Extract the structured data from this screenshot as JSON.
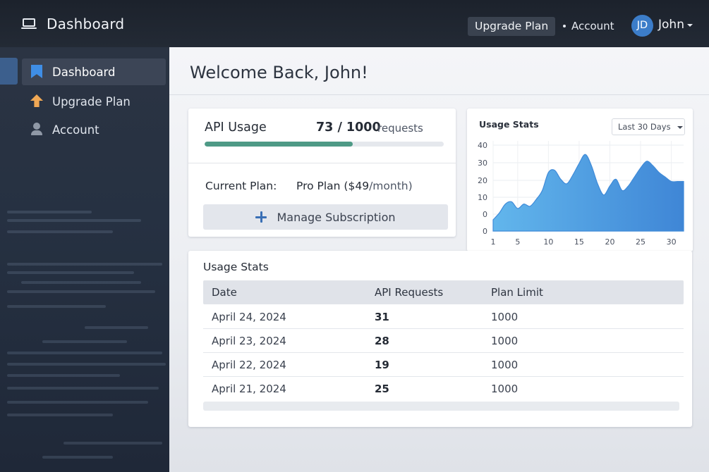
{
  "header": {
    "brand_title": "Dashboard",
    "upgrade_label": "Upgrade Plan",
    "account_label": "Account",
    "avatar_initials": "JD",
    "user_name": "John",
    "icons": {
      "brand": "laptop-icon",
      "user_menu": "chevron-down-icon"
    }
  },
  "sidebar": {
    "items": [
      {
        "label": "Dashboard",
        "icon": "bookmark-icon",
        "active": true,
        "color": "#3f8ee6"
      },
      {
        "label": "Upgrade Plan",
        "icon": "arrow-up-icon",
        "active": false,
        "color": "#f0a855"
      },
      {
        "label": "Account",
        "icon": "user-icon",
        "active": false,
        "color": "#8f98a6"
      }
    ]
  },
  "main": {
    "page_title": "Welcome Back, John!",
    "api_usage": {
      "label": "API Usage",
      "count": "73 / 1000",
      "unit": "requests",
      "progress_fraction": 0.62,
      "progress_color": "#4e9a86"
    },
    "plan": {
      "label": "Current Plan:",
      "value": "Pro Plan ($49",
      "suffix": "/month)",
      "manage_label": "Manage Subscription"
    },
    "usage_chart": {
      "title": "Usage Stats",
      "range_label": "Last 30 Days"
    },
    "table": {
      "title": "Usage Stats",
      "columns": [
        "Date",
        "API Requests",
        "Plan Limit"
      ],
      "rows": [
        [
          "April 24, 2024",
          "31",
          "1000"
        ],
        [
          "April 23, 2024",
          "28",
          "1000"
        ],
        [
          "April 22, 2024",
          "19",
          "1000"
        ],
        [
          "April 21, 2024",
          "25",
          "1000"
        ]
      ]
    }
  },
  "chart_data": {
    "type": "area",
    "title": "Usage Stats",
    "xlabel": "",
    "ylabel": "",
    "x_ticks": [
      1,
      5,
      10,
      15,
      20,
      25,
      30
    ],
    "y_ticks": [
      0,
      10,
      20,
      30,
      40
    ],
    "y_tick_labels": [
      "0",
      "0",
      "10",
      "20",
      "30",
      "40"
    ],
    "xlim": [
      1,
      32
    ],
    "ylim": [
      0,
      40
    ],
    "grid": true,
    "color": "#4a9be0",
    "x": [
      1,
      2,
      3,
      4,
      5,
      6,
      7,
      8,
      9,
      10,
      11,
      12,
      13,
      14,
      15,
      16,
      17,
      18,
      19,
      20,
      21,
      22,
      23,
      24,
      25,
      26,
      27,
      28,
      29,
      30,
      31,
      32
    ],
    "values": [
      5,
      8,
      12,
      13,
      10,
      12,
      11,
      14,
      18,
      26,
      27,
      23,
      21,
      25,
      30,
      34,
      29,
      21,
      16,
      20,
      23,
      18,
      20,
      24,
      28,
      31,
      29,
      26,
      24,
      22,
      22,
      22
    ]
  }
}
